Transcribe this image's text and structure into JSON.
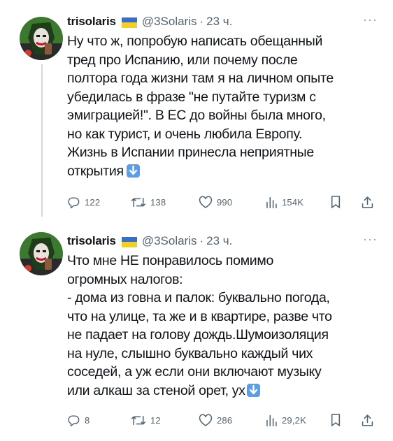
{
  "tweets": [
    {
      "author_name": "trisolaris",
      "author_handle": "@3Solaris",
      "dot": "·",
      "time": "23 ч.",
      "more": "···",
      "lines": [
        "Ну что ж, попробую написать обещанный",
        "тред про Испанию, или почему после",
        "полтора года жизни там я на личном опыте",
        "убедилась в фразе \"не путайте туризм с",
        "эмиграцией!\". В ЕС до войны была много,",
        "но как турист, и очень любила Европу.",
        "Жизнь в Испании принесла неприятные",
        "открытия"
      ],
      "actions": {
        "replies": "122",
        "retweets": "138",
        "likes": "990",
        "views": "154K"
      }
    },
    {
      "author_name": "trisolaris",
      "author_handle": "@3Solaris",
      "dot": "·",
      "time": "23 ч.",
      "more": "···",
      "lines": [
        "Что мне НЕ понравилось помимо",
        "огромных налогов:",
        "- дома из говна и палок: буквально погода,",
        "что на улице, та же и в квартире, разве что",
        "не падает на голову дождь.Шумоизоляция",
        "на нуле, слышно буквально каждый чих",
        "соседей, а уж если они включают музыку",
        "или алкаш за стеной орет, ух"
      ],
      "actions": {
        "replies": "8",
        "retweets": "12",
        "likes": "286",
        "views": "29,2K"
      }
    }
  ],
  "icons": {
    "flag": "ukraine-flag-icon",
    "end_emoji": "down-arrow-emoji-icon",
    "reply": "reply-icon",
    "retweet": "retweet-icon",
    "like": "heart-icon",
    "views": "views-icon",
    "bookmark": "bookmark-icon",
    "share": "share-icon"
  },
  "colors": {
    "text": "#0f1419",
    "secondary": "#536471",
    "flag_blue": "#2f6fd6",
    "flag_yellow": "#f5cf1f",
    "emoji_blue": "#5b9ee8",
    "thread_line": "#cfd9de"
  }
}
